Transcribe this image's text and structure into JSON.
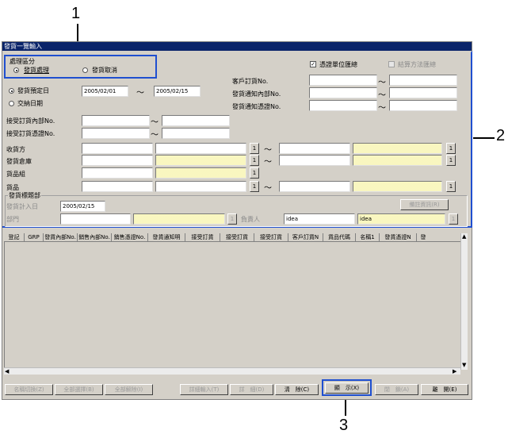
{
  "callouts": {
    "c1": "1",
    "c2": "2",
    "c3": "3"
  },
  "window": {
    "title": "發貨一覽輸入"
  },
  "process": {
    "group_label": "處理區分",
    "opt1": "發貨處理",
    "opt2": "發貨取消"
  },
  "options": {
    "voucher_group": "憑證單位匯總",
    "settle_group": "結算方法匯總"
  },
  "date": {
    "opt_planned": "發貨預定日",
    "opt_delivery": "交納日期",
    "from": "2005/02/01",
    "to": "2005/02/15"
  },
  "right_labels": {
    "cust_order": "客戶訂貨No.",
    "notice_inner": "發貨通知內部No.",
    "notice_voucher": "發貨通知憑證No."
  },
  "left_labels": {
    "recv_inner": "接受訂貨內部No.",
    "recv_voucher": "接受訂貨憑證No.",
    "consignee": "收貨方",
    "warehouse": "發貨倉庫",
    "item_group": "貨品組",
    "item": "貨品"
  },
  "header_section": {
    "title": "發貨標題部",
    "plan_date_label": "發貨計入日",
    "plan_date_value": "2005/02/15",
    "dept_label": "部門",
    "person_label": "負責人",
    "person_code": "idea",
    "person_name": "idea",
    "remark_button": "備註資訊(R)"
  },
  "small_btn": "1",
  "tilde": "～",
  "grid": {
    "columns": [
      "登記",
      "GRP",
      "發貨內部No.",
      "銷售內部No.",
      "銷售憑證No.",
      "發貨通知明",
      "接受訂貨",
      "接受訂貨",
      "接受訂貨",
      "客戶訂貨N",
      "貨品代碼",
      "名稱1",
      "發貨憑證N",
      "發"
    ]
  },
  "buttons": {
    "name_switch": "名稱切換(Z)",
    "select_all": "全部選擇(B)",
    "clear_all": "全部解除(I)",
    "detail_input": "詳細輸入(T)",
    "detail": "詳　細(D)",
    "delete": "清　除(C)",
    "display": "顯　示(X)",
    "close": "閉　鎖(A)",
    "exit": "離　開(E)"
  },
  "colors": {
    "highlight": "#1f4fd0",
    "title_bar": "#0a246a",
    "face": "#d4d0c8"
  }
}
